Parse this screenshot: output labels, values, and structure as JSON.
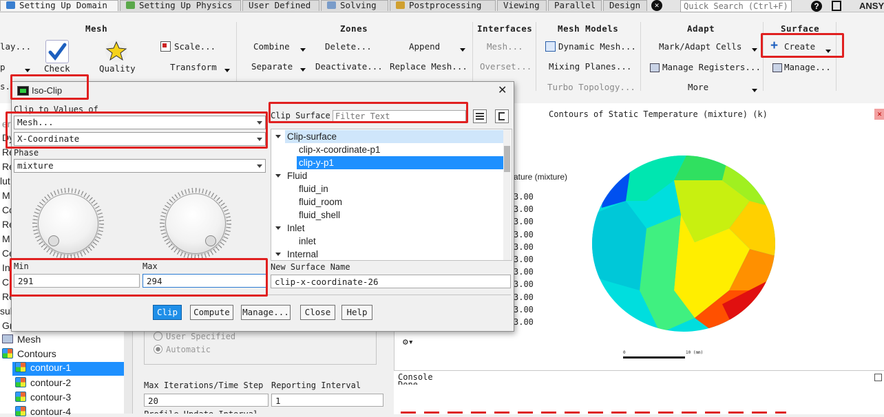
{
  "tabs": [
    {
      "label": "Setting Up Domain",
      "active": true
    },
    {
      "label": "Setting Up Physics"
    },
    {
      "label": "User Defined"
    },
    {
      "label": "Solving"
    },
    {
      "label": "Postprocessing"
    },
    {
      "label": "Viewing"
    },
    {
      "label": "Parallel"
    },
    {
      "label": "Design"
    }
  ],
  "quick_search": {
    "placeholder": "Quick Search (Ctrl+F)"
  },
  "brand": "ANSY",
  "ribbon": {
    "mesh": {
      "title": "Mesh",
      "display_partial": "lay...",
      "check": "Check",
      "quality": "Quality",
      "scale": "Scale...",
      "transform": "Transform",
      "partial_p": "p",
      "partial_s": "s..."
    },
    "zones": {
      "title": "Zones",
      "combine": "Combine",
      "separate": "Separate",
      "delete": "Delete...",
      "deactivate": "Deactivate...",
      "append": "Append",
      "replace_mesh": "Replace Mesh..."
    },
    "interfaces": {
      "title": "Interfaces",
      "mesh": "Mesh...",
      "overset": "Overset..."
    },
    "mesh_models": {
      "title": "Mesh Models",
      "dynamic_mesh": "Dynamic Mesh...",
      "mixing_planes": "Mixing Planes...",
      "turbo_topology": "Turbo Topology..."
    },
    "adapt": {
      "title": "Adapt",
      "mark_adapt": "Mark/Adapt Cells",
      "manage_registers": "Manage Registers...",
      "more": "More"
    },
    "surface": {
      "title": "Surface",
      "create": "Create",
      "manage": "Manage..."
    }
  },
  "tree": {
    "partial_rows": [
      "ert",
      "Dy",
      "Re",
      "Re",
      "lut",
      "M",
      "Co",
      "Re",
      "M",
      "Ce",
      "In",
      "Cl",
      "Re",
      "sul",
      "Gr"
    ],
    "mesh": "Mesh",
    "contours": "Contours",
    "items": [
      "contour-1",
      "contour-2",
      "contour-3",
      "contour-4"
    ]
  },
  "solution_panel": {
    "user_specified": "User Specified",
    "automatic": "Automatic",
    "max_iter_label": "Max Iterations/Time Step",
    "max_iter_value": "20",
    "reporting_label": "Reporting Interval",
    "reporting_value": "1",
    "profile_partial": "Profile Update Interval"
  },
  "graphics": {
    "title": "Contours of Static Temperature (mixture)  (k)",
    "legend_label": "ature (mixture)",
    "legend_values": [
      "3.00",
      "3.00",
      "3.00",
      "3.00",
      "3.00",
      "3.00",
      "3.00",
      "3.00",
      "3.00",
      "3.00",
      "3.00"
    ],
    "scale_left": "0",
    "scale_right": "10 (mm)"
  },
  "console": {
    "label": "Console",
    "text": "Done."
  },
  "dialog": {
    "title": "Iso-Clip",
    "clip_to_values_label": "Clip to Values of",
    "category_value": "Mesh...",
    "variable_value": "X-Coordinate",
    "phase_label": "Phase",
    "phase_value": "mixture",
    "min_label": "Min",
    "min_value": "291",
    "max_label": "Max",
    "max_value": "294",
    "clip_surface_label": "Clip Surface",
    "filter_placeholder": "Filter Text",
    "surface_tree": [
      {
        "label": "Clip-surface",
        "group": true,
        "selected": true
      },
      {
        "label": "clip-x-coordinate-p1"
      },
      {
        "label": "clip-y-p1",
        "selected": true
      },
      {
        "label": "Fluid",
        "group": true
      },
      {
        "label": "fluid_in"
      },
      {
        "label": "fluid_room"
      },
      {
        "label": "fluid_shell"
      },
      {
        "label": "Inlet",
        "group": true
      },
      {
        "label": "inlet"
      },
      {
        "label": "Internal",
        "group": true
      }
    ],
    "new_surface_name_label": "New Surface Name",
    "new_surface_name_value": "clip-x-coordinate-26",
    "buttons": {
      "clip": "Clip",
      "compute": "Compute",
      "manage": "Manage...",
      "close": "Close",
      "help": "Help"
    }
  },
  "colors": {
    "accent": "#1f8fe8",
    "highlight": "#e02020",
    "selection": "#1e90ff"
  }
}
